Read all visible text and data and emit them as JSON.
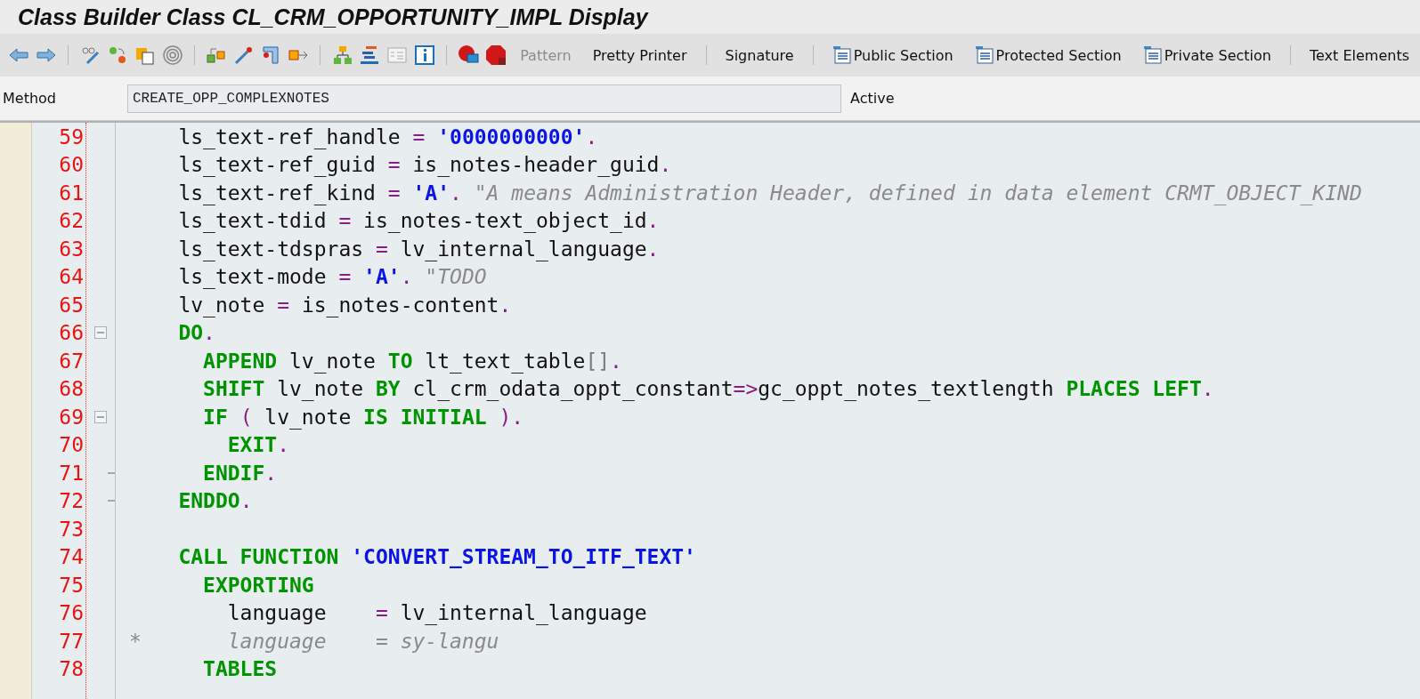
{
  "window": {
    "title": "Class Builder Class CL_CRM_OPPORTUNITY_IMPL Display"
  },
  "toolbar": {
    "buttons": [
      {
        "label": "Pattern",
        "disabled": true,
        "kind": "text"
      },
      {
        "label": "Pretty Printer",
        "disabled": false,
        "kind": "text"
      },
      {
        "label": "Signature",
        "disabled": false,
        "kind": "text"
      },
      {
        "label": "Public Section",
        "disabled": false,
        "kind": "section"
      },
      {
        "label": "Protected Section",
        "disabled": false,
        "kind": "section"
      },
      {
        "label": "Private Section",
        "disabled": false,
        "kind": "section"
      },
      {
        "label": "Text Elements",
        "disabled": false,
        "kind": "text"
      }
    ]
  },
  "method": {
    "label": "Method",
    "value": "CREATE_OPP_COMPLEXNOTES",
    "status": "Active"
  },
  "editor": {
    "lines": [
      {
        "number": "59",
        "kind": "plain",
        "tokens": [
          {
            "kind": "text",
            "text": "    ls_text-ref_handle "
          },
          {
            "kind": "operator",
            "text": "="
          },
          {
            "kind": "string",
            "text": " '0000000000'"
          },
          {
            "kind": "operator",
            "text": "."
          }
        ]
      },
      {
        "number": "60",
        "kind": "plain",
        "tokens": [
          {
            "kind": "text",
            "text": "    ls_text-ref_guid "
          },
          {
            "kind": "operator",
            "text": "="
          },
          {
            "kind": "text",
            "text": " is_notes-header_guid"
          },
          {
            "kind": "operator",
            "text": "."
          }
        ]
      },
      {
        "number": "61",
        "kind": "plain",
        "tokens": [
          {
            "kind": "text",
            "text": "    ls_text-ref_kind "
          },
          {
            "kind": "operator",
            "text": "="
          },
          {
            "kind": "string",
            "text": " 'A'"
          },
          {
            "kind": "operator",
            "text": "."
          },
          {
            "kind": "comment",
            "text": " \"A means Administration Header, defined in data element CRMT_OBJECT_KIND"
          }
        ]
      },
      {
        "number": "62",
        "kind": "plain",
        "tokens": [
          {
            "kind": "text",
            "text": "    ls_text-tdid "
          },
          {
            "kind": "operator",
            "text": "="
          },
          {
            "kind": "text",
            "text": " is_notes-text_object_id"
          },
          {
            "kind": "operator",
            "text": "."
          }
        ]
      },
      {
        "number": "63",
        "kind": "plain",
        "tokens": [
          {
            "kind": "text",
            "text": "    ls_text-tdspras "
          },
          {
            "kind": "operator",
            "text": "="
          },
          {
            "kind": "text",
            "text": " lv_internal_language"
          },
          {
            "kind": "operator",
            "text": "."
          }
        ]
      },
      {
        "number": "64",
        "kind": "plain",
        "tokens": [
          {
            "kind": "text",
            "text": "    ls_text-mode "
          },
          {
            "kind": "operator",
            "text": "="
          },
          {
            "kind": "string",
            "text": " 'A'"
          },
          {
            "kind": "operator",
            "text": "."
          },
          {
            "kind": "comment",
            "text": " \"TODO"
          }
        ]
      },
      {
        "number": "65",
        "kind": "plain",
        "tokens": [
          {
            "kind": "text",
            "text": "    lv_note "
          },
          {
            "kind": "operator",
            "text": "="
          },
          {
            "kind": "text",
            "text": " is_notes-content"
          },
          {
            "kind": "operator",
            "text": "."
          }
        ]
      },
      {
        "number": "66",
        "kind": "block_start",
        "tokens": [
          {
            "kind": "keyword",
            "text": "    DO"
          },
          {
            "kind": "operator",
            "text": "."
          }
        ]
      },
      {
        "number": "67",
        "kind": "plain",
        "tokens": [
          {
            "kind": "keyword",
            "text": "      APPEND"
          },
          {
            "kind": "text",
            "text": " lv_note "
          },
          {
            "kind": "keyword",
            "text": "TO"
          },
          {
            "kind": "text",
            "text": " lt_text_table"
          },
          {
            "kind": "bracket",
            "text": "[]"
          },
          {
            "kind": "operator",
            "text": "."
          }
        ]
      },
      {
        "number": "68",
        "kind": "plain",
        "tokens": [
          {
            "kind": "keyword",
            "text": "      SHIFT"
          },
          {
            "kind": "text",
            "text": " lv_note "
          },
          {
            "kind": "keyword",
            "text": "BY"
          },
          {
            "kind": "text",
            "text": " cl_crm_odata_oppt_constant"
          },
          {
            "kind": "operator",
            "text": "=>"
          },
          {
            "kind": "text",
            "text": "gc_oppt_notes_textlength "
          },
          {
            "kind": "keyword",
            "text": "PLACES LEFT"
          },
          {
            "kind": "operator",
            "text": "."
          }
        ]
      },
      {
        "number": "69",
        "kind": "block_start",
        "tokens": [
          {
            "kind": "keyword",
            "text": "      IF "
          },
          {
            "kind": "operator",
            "text": "("
          },
          {
            "kind": "text",
            "text": " lv_note "
          },
          {
            "kind": "keyword",
            "text": "IS INITIAL "
          },
          {
            "kind": "operator",
            "text": ")."
          }
        ]
      },
      {
        "number": "70",
        "kind": "plain",
        "tokens": [
          {
            "kind": "keyword",
            "text": "        EXIT"
          },
          {
            "kind": "operator",
            "text": "."
          }
        ]
      },
      {
        "number": "71",
        "kind": "block_end",
        "tokens": [
          {
            "kind": "keyword",
            "text": "      ENDIF"
          },
          {
            "kind": "operator",
            "text": "."
          }
        ]
      },
      {
        "number": "72",
        "kind": "block_end",
        "tokens": [
          {
            "kind": "keyword",
            "text": "    ENDDO"
          },
          {
            "kind": "operator",
            "text": "."
          }
        ]
      },
      {
        "number": "73",
        "kind": "plain"
      },
      {
        "number": "74",
        "kind": "plain",
        "tokens": [
          {
            "kind": "keyword",
            "text": "    CALL FUNCTION "
          },
          {
            "kind": "string",
            "text": "'CONVERT_STREAM_TO_ITF_TEXT'"
          }
        ]
      },
      {
        "number": "75",
        "kind": "plain",
        "tokens": [
          {
            "kind": "keyword",
            "text": "      EXPORTING"
          }
        ]
      },
      {
        "number": "76",
        "kind": "plain",
        "tokens": [
          {
            "kind": "text",
            "text": "        language    "
          },
          {
            "kind": "operator",
            "text": "="
          },
          {
            "kind": "text",
            "text": " lv_internal_language"
          }
        ]
      },
      {
        "number": "77",
        "kind": "plain",
        "tokens": [
          {
            "kind": "comment",
            "text": "*       language    = sy-langu"
          }
        ]
      },
      {
        "number": "78",
        "kind": "plain",
        "tokens": [
          {
            "kind": "keyword",
            "text": "      TABLES"
          }
        ]
      }
    ]
  }
}
